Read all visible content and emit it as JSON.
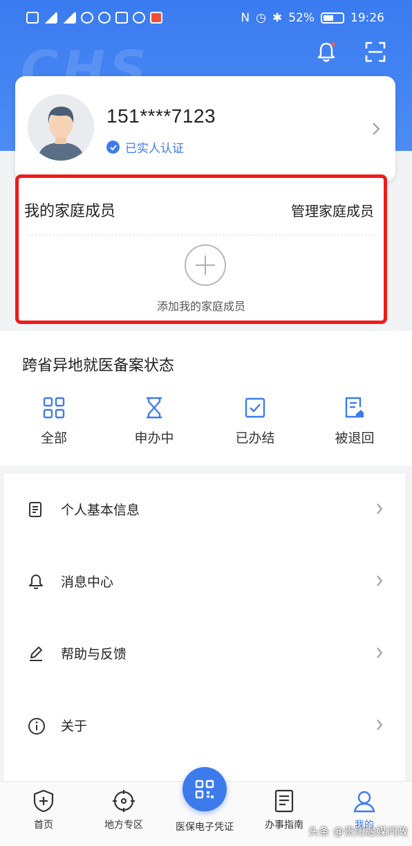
{
  "status_bar": {
    "battery": "52%",
    "time": "19:26"
  },
  "profile": {
    "phone": "151****7123",
    "verified": "已实人认证"
  },
  "family": {
    "title": "我的家庭成员",
    "manage": "管理家庭成员",
    "add_label": "添加我的家庭成员"
  },
  "record": {
    "title": "跨省异地就医备案状态",
    "items": [
      {
        "label": "全部",
        "icon": "grid-icon"
      },
      {
        "label": "申办中",
        "icon": "hourglass-icon"
      },
      {
        "label": "已办结",
        "icon": "check-box-icon"
      },
      {
        "label": "被退回",
        "icon": "returned-doc-icon"
      }
    ]
  },
  "menu": [
    {
      "label": "个人基本信息",
      "icon": "document-icon"
    },
    {
      "label": "消息中心",
      "icon": "bell-icon"
    },
    {
      "label": "帮助与反馈",
      "icon": "pen-icon"
    },
    {
      "label": "关于",
      "icon": "info-icon"
    }
  ],
  "tabbar": [
    {
      "label": "首页",
      "icon": "shield-icon"
    },
    {
      "label": "地方专区",
      "icon": "target-icon"
    },
    {
      "label": "医保电子凭证",
      "icon": "qr-icon"
    },
    {
      "label": "办事指南",
      "icon": "guide-doc-icon"
    },
    {
      "label": "我的",
      "icon": "user-icon"
    }
  ],
  "watermark": "头条 @贵阳融媒问政",
  "colors": {
    "primary": "#3d7bec",
    "highlight_border": "#f01a1a"
  }
}
